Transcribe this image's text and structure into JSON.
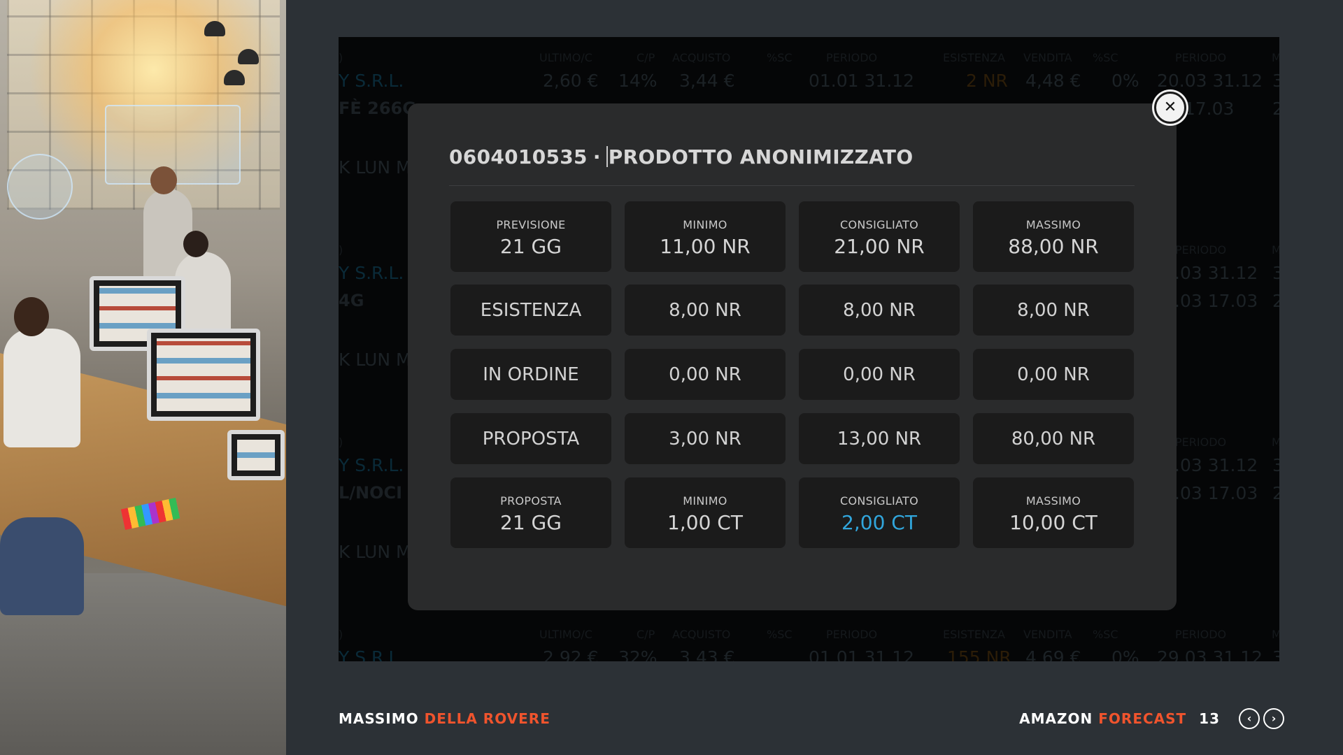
{
  "modal": {
    "code": "0604010535",
    "separator": "·",
    "title": "PRODOTTO ANONIMIZZATO",
    "close_icon": "close-icon",
    "row1": [
      {
        "label": "PREVISIONE",
        "value": "21 GG"
      },
      {
        "label": "MINIMO",
        "value": "11,00 NR"
      },
      {
        "label": "CONSIGLIATO",
        "value": "21,00 NR"
      },
      {
        "label": "MASSIMO",
        "value": "88,00 NR"
      }
    ],
    "row_esistenza": [
      "ESISTENZA",
      "8,00 NR",
      "8,00 NR",
      "8,00 NR"
    ],
    "row_ordine": [
      "IN ORDINE",
      "0,00 NR",
      "0,00 NR",
      "0,00 NR"
    ],
    "row_proposta": [
      "PROPOSTA",
      "3,00 NR",
      "13,00 NR",
      "80,00 NR"
    ],
    "row5": [
      {
        "label": "PROPOSTA",
        "value": "21 GG"
      },
      {
        "label": "MINIMO",
        "value": "1,00 CT"
      },
      {
        "label": "CONSIGLIATO",
        "value": "2,00 CT"
      },
      {
        "label": "MASSIMO",
        "value": "10,00 CT"
      }
    ],
    "accent_color": "#31a6dc"
  },
  "background_table": {
    "headers": [
      "ULTIMO/C",
      "C/P",
      "ACQUISTO",
      "%SC",
      "PERIODO",
      "ESISTENZA",
      "VENDITA",
      "%SC",
      "PERIODO",
      "M"
    ],
    "block1": {
      "supplier": "Y S.R.L.",
      "values": [
        "2,60 €",
        "14%",
        "3,44 €",
        "01.01 31.12",
        "2 NR",
        "4,48 €",
        "0%",
        "20.03 31.12",
        "3"
      ],
      "product": "FÈ 266G",
      "period2": "5 17.03",
      "num2": "2",
      "footer": "K LUN M"
    },
    "block2": {
      "supplier": "Y S.R.L.",
      "period": "PERIODO",
      "period1": ".03 31.12",
      "num1": "3",
      "product": "4G",
      "period2": ".03 17.03",
      "num2": "2",
      "footer": "K LUN M"
    },
    "block3": {
      "supplier": "Y S.R.L.",
      "period": "PERIODO",
      "period1": ".03 31.12",
      "num1": "3",
      "product": "L/NOCI",
      "period2": ".03 17.03",
      "num2": "2",
      "footer": "K LUN M"
    },
    "block4": {
      "values": [
        "2,92 €",
        "32%",
        "3,43 €",
        "01.01 31.12",
        "155 NR",
        "4,69 €",
        "0%",
        "29.03 31.12",
        "3"
      ],
      "supplier": "Y S.R.L"
    }
  },
  "footer": {
    "author_first": "MASSIMO",
    "author_last": "DELLA ROVERE",
    "title_first": "AMAZON",
    "title_last": "FORECAST",
    "page": "13",
    "prev_icon": "chevron-left-icon",
    "next_icon": "chevron-right-icon",
    "highlight_color": "#f0542d"
  }
}
